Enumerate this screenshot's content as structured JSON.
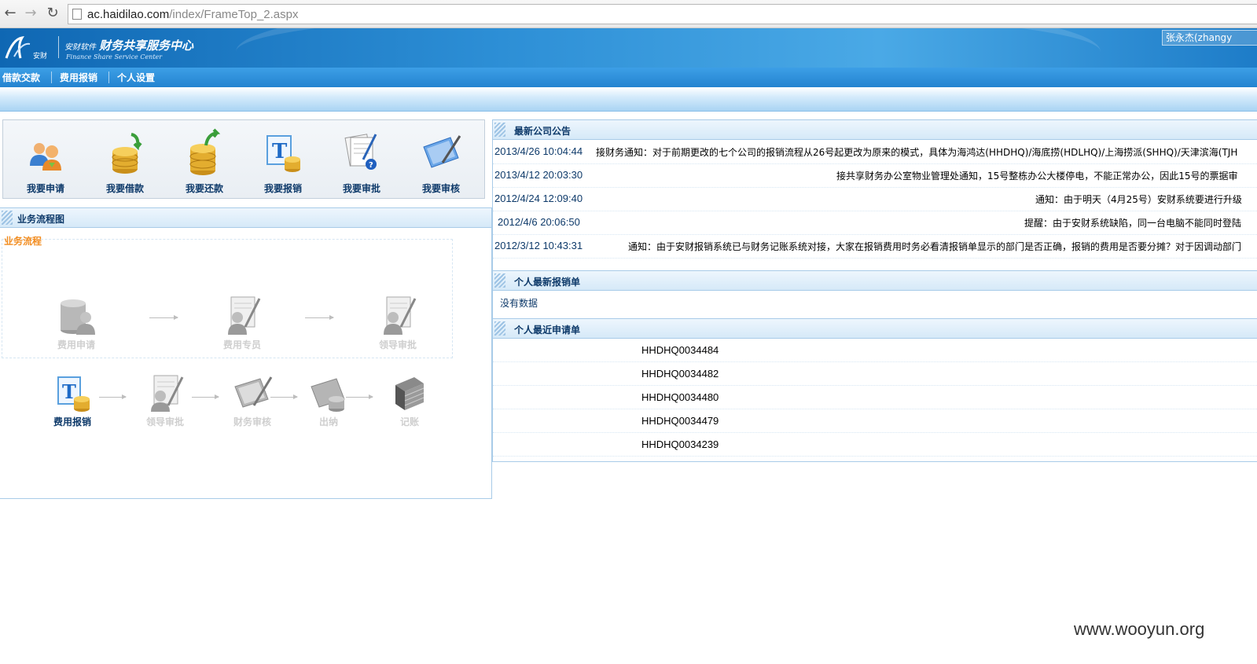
{
  "browser": {
    "url_host": "ac.haidilao.com",
    "url_path": "/index/FrameTop_2.aspx",
    "back_icon": "back-arrow-icon",
    "forward_icon": "forward-arrow-icon",
    "reload_icon": "reload-icon"
  },
  "header": {
    "logo_text": "安财",
    "brand_small": "安财软件",
    "brand_title": "财务共享服务中心",
    "brand_sub": "Finance Share Service Center",
    "user": "张永杰(zhangy"
  },
  "menu": [
    "借款交款",
    "费用报销",
    "个人设置"
  ],
  "quick_actions": [
    {
      "label": "我要申请",
      "icon": "users-icon"
    },
    {
      "label": "我要借款",
      "icon": "coins-in-icon"
    },
    {
      "label": "我要还款",
      "icon": "coins-out-icon"
    },
    {
      "label": "我要报销",
      "icon": "reimburse-icon"
    },
    {
      "label": "我要审批",
      "icon": "approve-icon"
    },
    {
      "label": "我要审核",
      "icon": "audit-icon"
    }
  ],
  "flow": {
    "section_title": "业务流程图",
    "subtitle": "业务流程",
    "row1": [
      "费用申请",
      "费用专员",
      "领导审批"
    ],
    "row2": [
      "费用报销",
      "领导审批",
      "财务审核",
      "出纳",
      "记账"
    ]
  },
  "notices": {
    "title": "最新公司公告",
    "items": [
      {
        "date": "2013/4/26 10:04:44",
        "text": "接财务通知：对于前期更改的七个公司的报销流程从26号起更改为原来的模式，具体为海鸿达(HHDHQ)/海底捞(HDLHQ)/上海捞派(SHHQ)/天津滨海(TJH"
      },
      {
        "date": "2013/4/12 20:03:30",
        "text": "接共享财务办公室物业管理处通知，15号整栋办公大楼停电，不能正常办公，因此15号的票据审"
      },
      {
        "date": "2012/4/24 12:09:40",
        "text": "通知：由于明天（4月25号）安财系统要进行升级"
      },
      {
        "date": "2012/4/6 20:06:50",
        "text": "提醒：由于安财系统缺陷，同一台电脑不能同时登陆"
      },
      {
        "date": "2012/3/12 10:43:31",
        "text": "通知：由于安财报销系统已与财务记账系统对接，大家在报销费用时务必看清报销单显示的部门是否正确，报销的费用是否要分摊？对于因调动部门"
      }
    ]
  },
  "personal_reimb": {
    "title": "个人最新报销单",
    "empty": "没有数据"
  },
  "personal_apps": {
    "title": "个人最近申请单",
    "items": [
      "HHDHQ0034484",
      "HHDHQ0034482",
      "HHDHQ0034480",
      "HHDHQ0034479",
      "HHDHQ0034239"
    ]
  },
  "watermark": "www.wooyun.org",
  "colors": {
    "header_blue": "#1d7cc8",
    "title_navy": "#0e3a6a",
    "flow_orange": "#f28d21"
  }
}
